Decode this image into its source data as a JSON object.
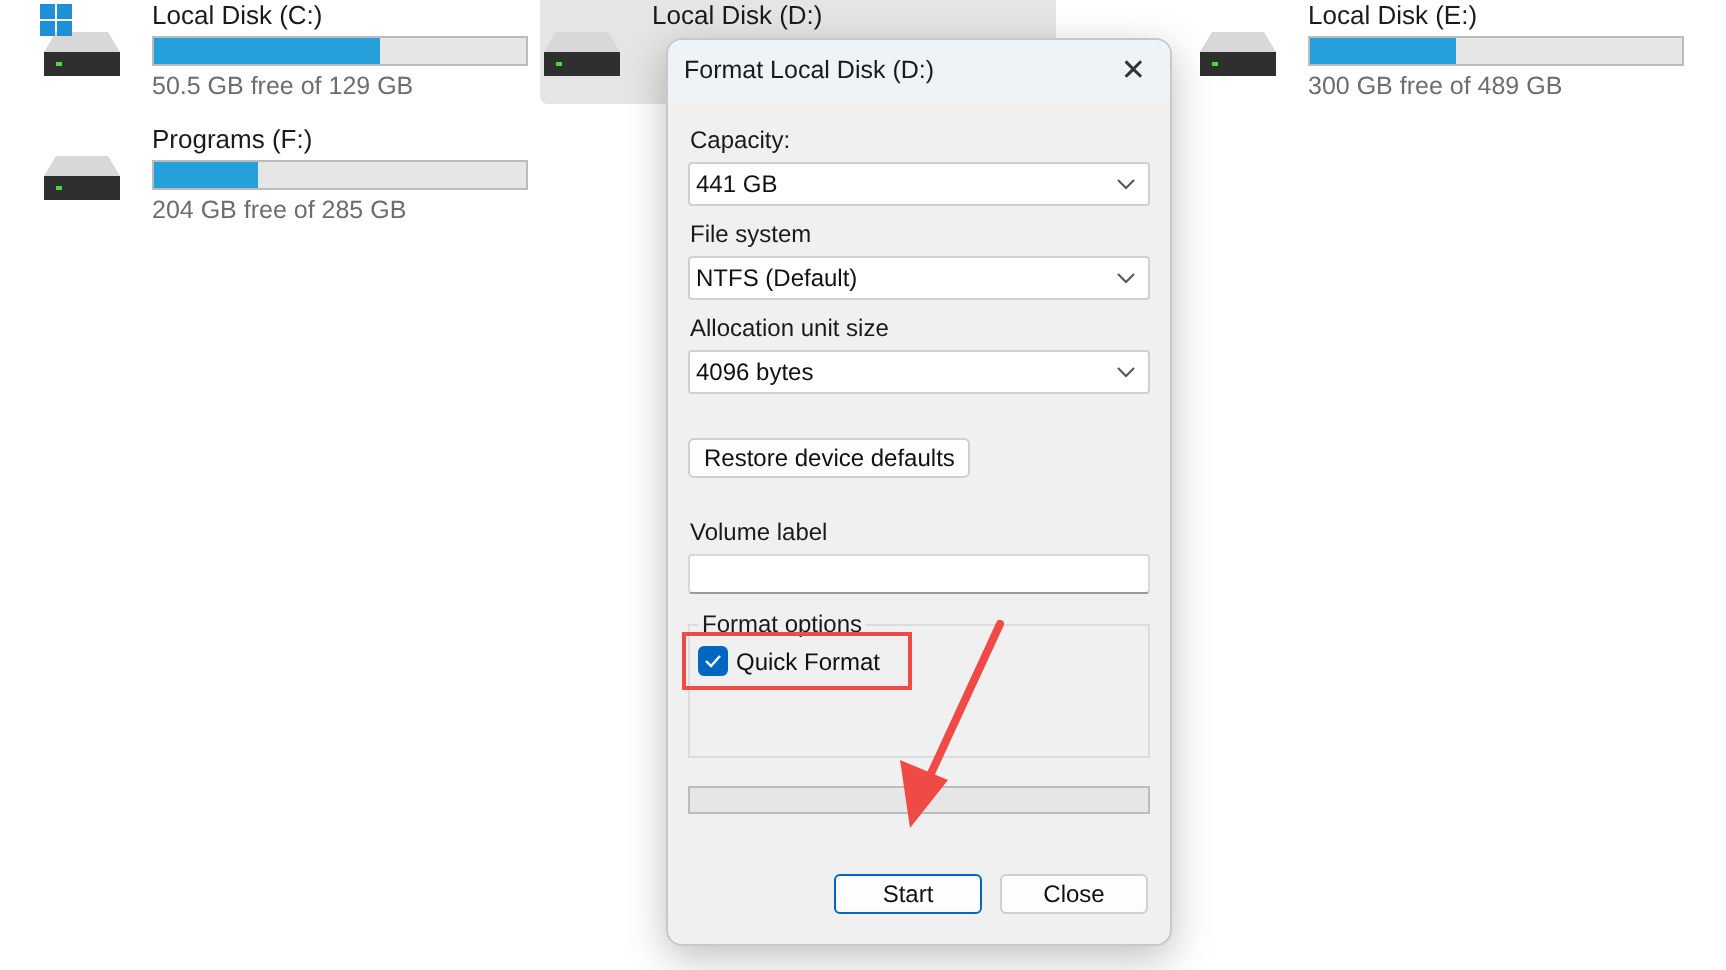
{
  "drives": [
    {
      "label": "Local Disk (C:)",
      "free": "50.5 GB free of 129 GB",
      "level": 0.61,
      "system": true,
      "selected": false
    },
    {
      "label": "Local Disk (D:)",
      "selected": true,
      "system": false
    },
    {
      "label": "Local Disk (E:)",
      "free": "300 GB free of 489 GB",
      "level": 0.39,
      "system": false,
      "selected": false
    },
    {
      "label": "Programs (F:)",
      "free": "204 GB free of 285 GB",
      "level": 0.28,
      "system": false,
      "selected": false
    }
  ],
  "dialog": {
    "title": "Format Local Disk (D:)",
    "close": "✕",
    "selects": [
      {
        "label": "Capacity:",
        "value": "441 GB"
      },
      {
        "label": "File system",
        "value": "NTFS (Default)"
      },
      {
        "label": "Allocation unit size",
        "value": "4096 bytes"
      }
    ],
    "restore_button": "Restore device defaults",
    "volume_label": {
      "label": "Volume label"
    },
    "format_options": {
      "title": "Format options",
      "options": [
        {
          "label": "Quick Format",
          "checked": true,
          "highlighted": true
        }
      ]
    },
    "progress": {
      "level": 0
    },
    "buttons": [
      {
        "label": "Start",
        "default": true
      },
      {
        "label": "Close",
        "default": false
      }
    ]
  },
  "pointer_arrow": true
}
